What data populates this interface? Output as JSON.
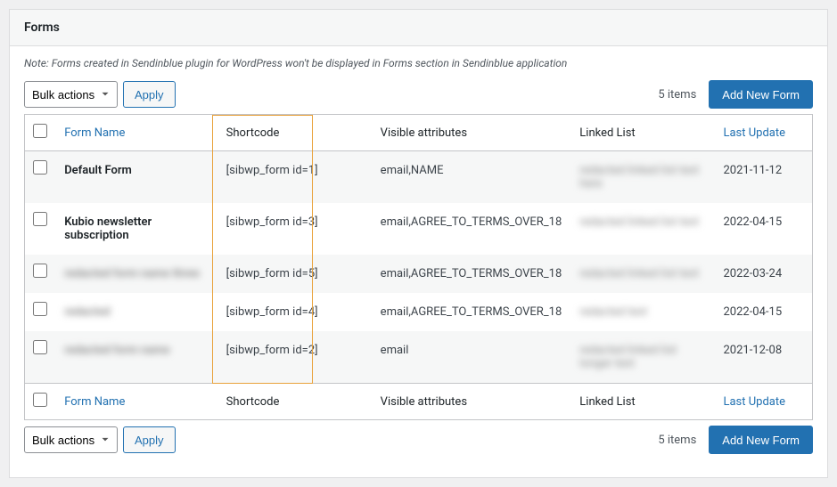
{
  "title": "Forms",
  "note": "Note: Forms created in Sendinblue plugin for WordPress won't be displayed in Forms section in Sendinblue application",
  "bulkActions": {
    "label": "Bulk actions",
    "apply": "Apply"
  },
  "itemsCount": "5 items",
  "addNew": "Add New Form",
  "columns": {
    "formName": "Form Name",
    "shortcode": "Shortcode",
    "visible": "Visible attributes",
    "linked": "Linked List",
    "lastUpdate": "Last Update"
  },
  "rows": [
    {
      "name": "Default Form",
      "nameBlur": false,
      "shortcode": "[sibwp_form id=1]",
      "visible": "email,NAME",
      "linked": "redacted linked list text here",
      "linkedBlur": true,
      "lastUpdate": "2021-11-12"
    },
    {
      "name": "Kubio newsletter subscription",
      "nameBlur": false,
      "shortcode": "[sibwp_form id=3]",
      "visible": "email,AGREE_TO_TERMS_OVER_18",
      "linked": "redacted linked list text",
      "linkedBlur": true,
      "lastUpdate": "2022-04-15"
    },
    {
      "name": "redacted form name three",
      "nameBlur": true,
      "shortcode": "[sibwp_form id=5]",
      "visible": "email,AGREE_TO_TERMS_OVER_18",
      "linked": "redacted linked list text",
      "linkedBlur": true,
      "lastUpdate": "2022-03-24"
    },
    {
      "name": "redacted",
      "nameBlur": true,
      "shortcode": "[sibwp_form id=4]",
      "visible": "email,AGREE_TO_TERMS_OVER_18",
      "linked": "redacted text",
      "linkedBlur": true,
      "lastUpdate": "2022-04-15"
    },
    {
      "name": "redacted form name",
      "nameBlur": true,
      "shortcode": "[sibwp_form id=2]",
      "visible": "email",
      "linked": "redacted linked list longer text",
      "linkedBlur": true,
      "lastUpdate": "2021-12-08"
    }
  ]
}
